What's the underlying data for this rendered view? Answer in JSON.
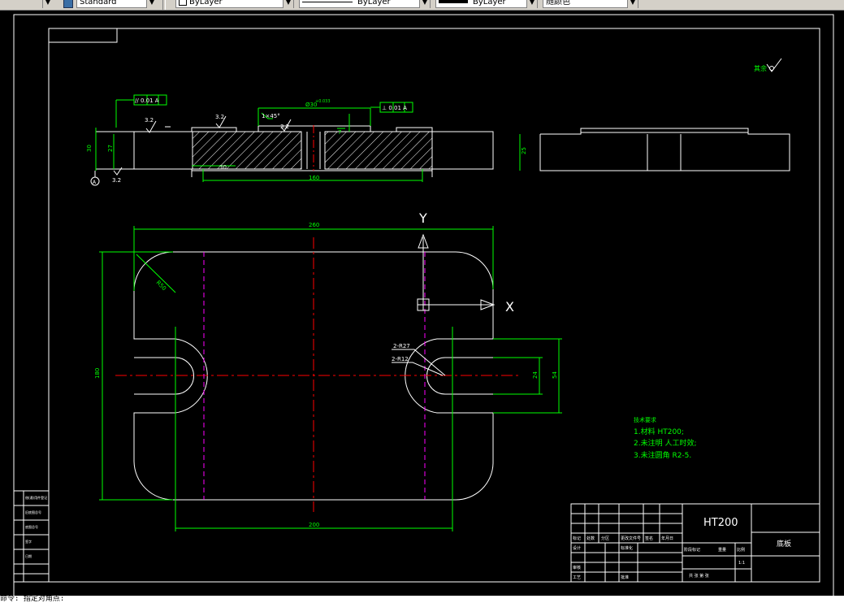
{
  "toolbar": {
    "text_style": "Standard",
    "layer": "ByLayer",
    "linetype": "ByLayer",
    "lineweight": "ByLayer",
    "plot_color": "随颜色"
  },
  "drawing": {
    "roughness_note": "其余",
    "section_dims": {
      "parallel_tol": "// 0.01 A",
      "perp_tol": "⊥ 0.01 A",
      "d30": "30",
      "d27": "27",
      "d25": "25",
      "r32_a": "3.2",
      "r32_b": "3.2",
      "r32_c": "3.2",
      "r32_d": "3.2",
      "bore": "Ø30",
      "bore_tol": "+0.033",
      "chamfer": "1×45°",
      "d7": "7",
      "d160": "160",
      "d30b": "30",
      "datum": "A"
    },
    "axis_y": "Y",
    "axis_x": "X",
    "plan_dims": {
      "d260": "260",
      "r50": "R50",
      "d180": "180",
      "d200": "200",
      "r27": "2-R27",
      "r12": "2-R12",
      "d24": "24",
      "d54": "54"
    },
    "notes": {
      "title": "技术要求",
      "items": [
        "1.材料 HT200;",
        "2.未注明 人工时效;",
        "3.未注圆角 R2-5."
      ]
    },
    "title_block": {
      "material": "HT200",
      "part_name": "底板",
      "row_labels": [
        "标记",
        "处数",
        "分区",
        "更改文件号",
        "签名",
        "年月日"
      ],
      "design": "设计",
      "check": "审核",
      "process": "工艺",
      "standard": "标准化",
      "approve": "批准",
      "stage": "阶段标记",
      "weight": "重量",
      "scale": "比例",
      "scale_value": "1:1",
      "sheet": "共 张 第 张"
    },
    "left_block": [
      "借(通)用件登记",
      "旧底图总号",
      "底图总号",
      "签字",
      "日期"
    ]
  },
  "command": {
    "prompt": "命令: 指定对角点:"
  },
  "colors": {
    "background": "#000000",
    "outline": "#ffffff",
    "dimension": "#00ff00",
    "centerline": "#ff0000",
    "hidden": "#ff00ff",
    "hatch": "#ffffff"
  }
}
